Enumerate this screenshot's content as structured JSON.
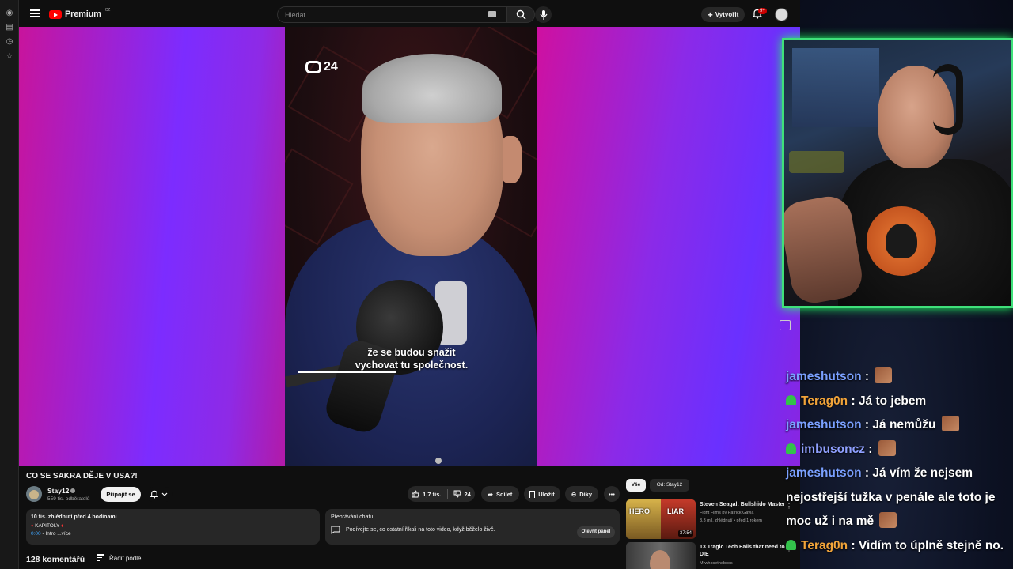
{
  "topbar": {
    "logo_text": "Premium",
    "logo_region": "CZ",
    "search_placeholder": "Hledat",
    "create_label": "Vytvořit",
    "notif_count": "9+"
  },
  "video": {
    "watermark": "24",
    "subtitle_line1": "že se budou snažit",
    "subtitle_line2": "vychovat tu společnost.",
    "title": "CO SE SAKRA DĚJE V USA?!"
  },
  "channel": {
    "name": "Stay12",
    "subscribers": "559 tis. odběratelů",
    "join_label": "Připojit se"
  },
  "actions": {
    "likes": "1,7 tis.",
    "dislikes": "24",
    "share": "Sdílet",
    "save": "Uložit",
    "thanks": "Díky"
  },
  "description": {
    "stats": "10 tis. zhlédnutí  před 4 hodinami",
    "chapters": "KAPITOLY",
    "timestamp": "0:00",
    "intro": "Intro",
    "more": "...více"
  },
  "chat_replay": {
    "heading": "Přehrávání chatu",
    "text": "Podívejte se, co ostatní říkali na toto video, když běželo živě.",
    "button": "Otevřít panel"
  },
  "comments": {
    "count": "128 komentářů",
    "sort": "Řadit podle"
  },
  "chips": [
    "Vše",
    "Od: Stay12"
  ],
  "recommendations": [
    {
      "title": "Steven Seagal: Bullshido Master",
      "channel": "Fight Films by Patrick Gavia",
      "meta": "3,3 mil. zhlédnutí • před 1 rokem",
      "duration": "37:54",
      "thumb_left": "HERO",
      "thumb_right": "LIAR"
    },
    {
      "title": "13 Tragic Tech Fails that need to DIE",
      "channel": "Mrwhosetheboss"
    }
  ],
  "stream_chat": [
    {
      "user": "jameshutson",
      "text": "",
      "emote": true,
      "sub": false,
      "color": "#7aa0ff"
    },
    {
      "user": "Terag0n",
      "text": "Já to jebem",
      "emote": false,
      "sub": true,
      "color": "#f2a43a"
    },
    {
      "user": "jameshutson",
      "text": "Já nemůžu",
      "emote": true,
      "sub": false,
      "color": "#7aa0ff"
    },
    {
      "user": "imbusoncz",
      "text": "",
      "emote": true,
      "sub": true,
      "color": "#8fa0ff"
    },
    {
      "user": "jameshutson",
      "text": "Já vím že nejsem nejostřejší tužka v penále ale toto je moc už i na mě",
      "emote": true,
      "sub": false,
      "color": "#7aa0ff"
    },
    {
      "user": "Terag0n",
      "text": "Vidím to úplně stejně no.",
      "emote": false,
      "sub": true,
      "color": "#f2a43a"
    }
  ]
}
